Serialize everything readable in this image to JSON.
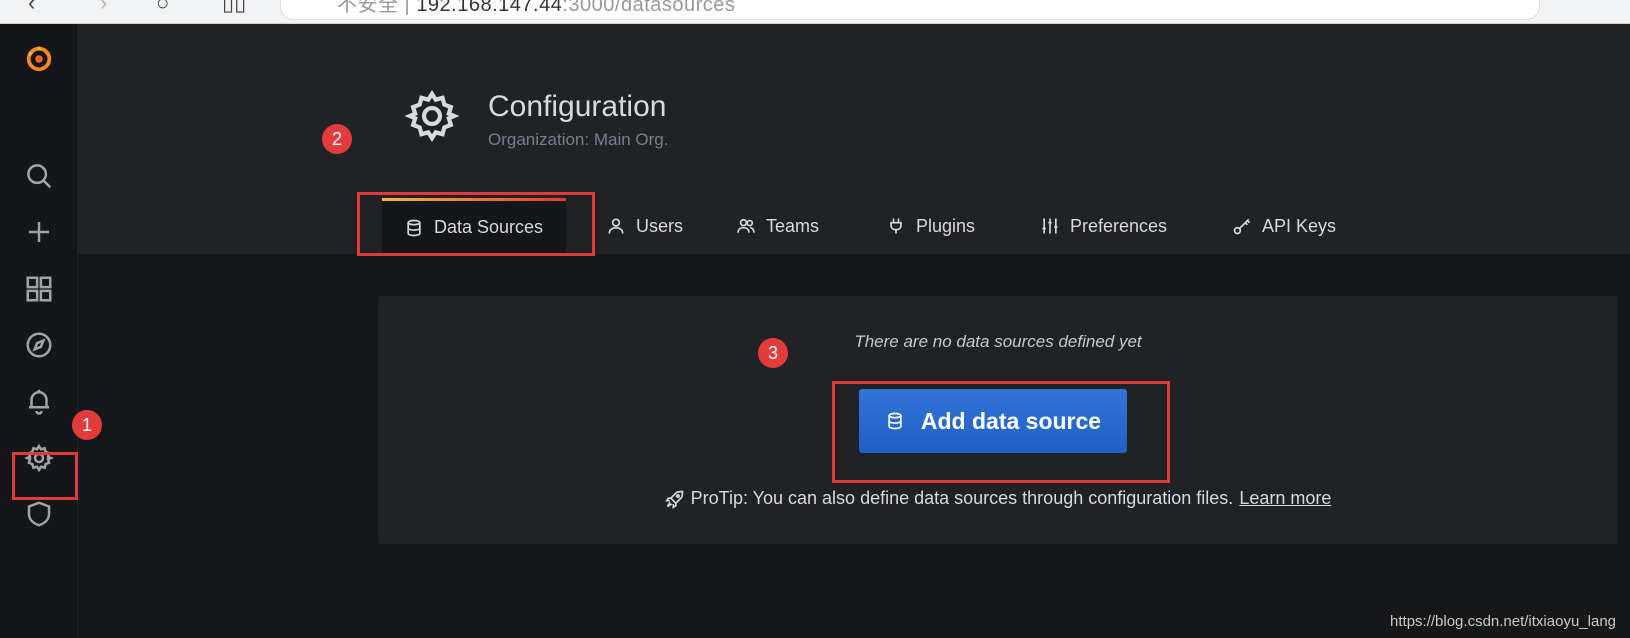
{
  "browser": {
    "url_host": "192.168.147.44",
    "url_rest": ":3000/datasources",
    "security_label": "不安全"
  },
  "sidebar": {
    "items": [
      {
        "name": "grafana-logo"
      },
      {
        "name": "search"
      },
      {
        "name": "create"
      },
      {
        "name": "dashboards"
      },
      {
        "name": "explore"
      },
      {
        "name": "alerting"
      },
      {
        "name": "configuration"
      },
      {
        "name": "server-admin"
      }
    ]
  },
  "header": {
    "title": "Configuration",
    "subtitle": "Organization: Main Org."
  },
  "tabs": [
    {
      "label": "Data Sources",
      "active": true,
      "icon": "database-icon"
    },
    {
      "label": "Users",
      "active": false,
      "icon": "user-icon"
    },
    {
      "label": "Teams",
      "active": false,
      "icon": "users-icon"
    },
    {
      "label": "Plugins",
      "active": false,
      "icon": "plug-icon"
    },
    {
      "label": "Preferences",
      "active": false,
      "icon": "sliders-icon"
    },
    {
      "label": "API Keys",
      "active": false,
      "icon": "key-icon"
    }
  ],
  "empty_state": {
    "message": "There are no data sources defined yet",
    "button_label": "Add data source",
    "protip_text": "ProTip: You can also define data sources through configuration files.",
    "protip_link": "Learn more"
  },
  "annotations": {
    "badge_1": "1",
    "badge_2": "2",
    "badge_3": "3"
  },
  "watermark": "https://blog.csdn.net/itxiaoyu_lang",
  "colors": {
    "accent_blue": "#3274d9",
    "tab_underline": "#f5b73b",
    "annotation_red": "#e03a3a"
  }
}
